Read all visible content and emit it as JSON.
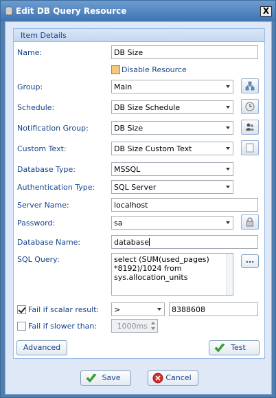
{
  "window": {
    "title": "Edit DB Query Resource",
    "close_glyph": "X"
  },
  "panel": {
    "header": "Item Details"
  },
  "fields": {
    "name": {
      "label": "Name:",
      "value": "DB Size"
    },
    "disable_resource": {
      "label": "Disable Resource",
      "checked": false
    },
    "group": {
      "label": "Group:",
      "value": "Main"
    },
    "schedule": {
      "label": "Schedule:",
      "value": "DB Size Schedule"
    },
    "notification_group": {
      "label": "Notification Group:",
      "value": "DB Size"
    },
    "custom_text": {
      "label": "Custom Text:",
      "value": "DB Size Custom Text"
    },
    "database_type": {
      "label": "Database Type:",
      "value": "MSSQL"
    },
    "authentication_type": {
      "label": "Authentication Type:",
      "value": "SQL Server"
    },
    "server_name": {
      "label": "Server Name:",
      "value": "localhost"
    },
    "password": {
      "label": "Password:",
      "value": "sa"
    },
    "database_name": {
      "label": "Database Name:",
      "value": "database"
    },
    "sql_query": {
      "label": "SQL Query:",
      "line1": "select (SUM(used_pages)",
      "line2": "*8192)/1024 from",
      "line3": "sys.allocation_units",
      "browse_label": "..."
    },
    "fail_scalar": {
      "label": "Fail if scalar result:",
      "checked": true,
      "operator": ">",
      "value": "8388608"
    },
    "fail_slower": {
      "label": "Fail if slower than:",
      "checked": false,
      "value": "1000ms"
    }
  },
  "buttons": {
    "advanced": "Advanced",
    "test": "Test",
    "save": "Save",
    "cancel": "Cancel"
  },
  "icons": {
    "group_browse": "network-icon",
    "schedule_browse": "clock-icon",
    "notification_browse": "people-icon",
    "custom_text_browse": "document-icon",
    "password_lock": "lock-icon",
    "test": "checkmark-icon",
    "save": "checkmark-icon",
    "cancel": "cancel-icon"
  },
  "colors": {
    "title_bar": "#4f7eaf",
    "label_text": "#15428b",
    "panel_border": "#99bbe8",
    "checkmark_green": "#3aa635",
    "cancel_red": "#d22c2c"
  }
}
